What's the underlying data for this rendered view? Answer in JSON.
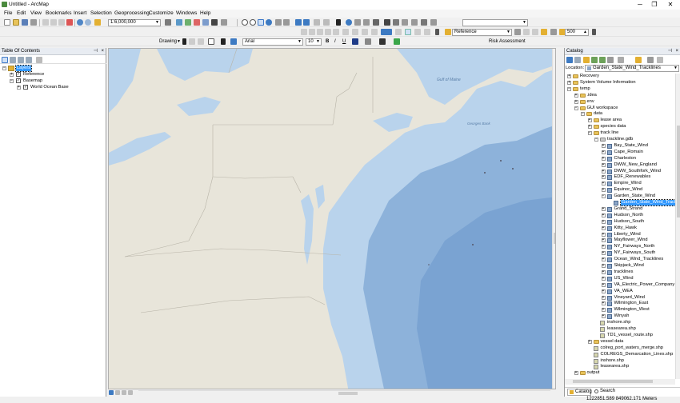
{
  "window": {
    "title": "Untitled - ArcMap",
    "minimize": "─",
    "maximize": "❐",
    "close": "✕"
  },
  "menu": [
    "File",
    "Edit",
    "View",
    "Bookmarks",
    "Insert",
    "Selection",
    "Geoprocessing",
    "Customize",
    "Windows",
    "Help"
  ],
  "toolbar": {
    "scale": "1:6,000,000",
    "drawing_label": "Drawing",
    "font_name": "Arial",
    "font_size": "10",
    "bold": "B",
    "italic": "I",
    "underline": "U",
    "reference_layer": "Reference",
    "zoom_value": "500",
    "risk_assessment": "Risk Assessment"
  },
  "toc": {
    "title": "Table Of Contents",
    "items": [
      {
        "label": "Layers",
        "level": 0,
        "selected": true
      },
      {
        "label": "Reference",
        "level": 1
      },
      {
        "label": "Basemap",
        "level": 1
      },
      {
        "label": "World Ocean Base",
        "level": 2
      }
    ]
  },
  "catalog": {
    "title": "Catalog",
    "location_label": "Location:",
    "location_value": "Garden_State_Wind_Tracklines",
    "items": [
      {
        "label": "Recovery",
        "level": 0,
        "type": "folder"
      },
      {
        "label": "System Volume Information",
        "level": 0,
        "type": "folder"
      },
      {
        "label": "temp",
        "level": 0,
        "type": "folder"
      },
      {
        "label": ".idea",
        "level": 1,
        "type": "folder"
      },
      {
        "label": "env",
        "level": 1,
        "type": "folder"
      },
      {
        "label": "GUI workspace",
        "level": 1,
        "type": "folder"
      },
      {
        "label": "data",
        "level": 2,
        "type": "folder"
      },
      {
        "label": "lease area",
        "level": 3,
        "type": "folder"
      },
      {
        "label": "species data",
        "level": 3,
        "type": "folder"
      },
      {
        "label": "track line",
        "level": 3,
        "type": "folder"
      },
      {
        "label": "trackline.gdb",
        "level": 4,
        "type": "gdb"
      },
      {
        "label": "Bay_State_Wind",
        "level": 5,
        "type": "fc"
      },
      {
        "label": "Cape_Romain",
        "level": 5,
        "type": "fc"
      },
      {
        "label": "Charleston",
        "level": 5,
        "type": "fc"
      },
      {
        "label": "DWW_New_England",
        "level": 5,
        "type": "fc"
      },
      {
        "label": "DWW_Southfork_Wind",
        "level": 5,
        "type": "fc"
      },
      {
        "label": "EDF_Renewables",
        "level": 5,
        "type": "fc"
      },
      {
        "label": "Empire_Wind",
        "level": 5,
        "type": "fc"
      },
      {
        "label": "Equinor_Wind",
        "level": 5,
        "type": "fc"
      },
      {
        "label": "Garden_State_Wind",
        "level": 5,
        "type": "fc"
      },
      {
        "label": "Garden_State_Wind_Tracklines",
        "level": 6,
        "type": "fc",
        "selected": true
      },
      {
        "label": "Grand_Strand",
        "level": 5,
        "type": "fc"
      },
      {
        "label": "Hudson_North",
        "level": 5,
        "type": "fc"
      },
      {
        "label": "Hudson_South",
        "level": 5,
        "type": "fc"
      },
      {
        "label": "Kitty_Hawk",
        "level": 5,
        "type": "fc"
      },
      {
        "label": "Liberty_Wind",
        "level": 5,
        "type": "fc"
      },
      {
        "label": "Mayflower_Wind",
        "level": 5,
        "type": "fc"
      },
      {
        "label": "NY_Fairways_North",
        "level": 5,
        "type": "fc"
      },
      {
        "label": "NY_Fairways_South",
        "level": 5,
        "type": "fc"
      },
      {
        "label": "Ocean_Wind_Tracklines",
        "level": 5,
        "type": "fc"
      },
      {
        "label": "Skipjack_Wind",
        "level": 5,
        "type": "fc"
      },
      {
        "label": "tracklines",
        "level": 5,
        "type": "fc"
      },
      {
        "label": "US_Wind",
        "level": 5,
        "type": "fc"
      },
      {
        "label": "VA_Electric_Power_Company",
        "level": 5,
        "type": "fc"
      },
      {
        "label": "VA_WEA",
        "level": 5,
        "type": "fc"
      },
      {
        "label": "Vineyard_Wind",
        "level": 5,
        "type": "fc"
      },
      {
        "label": "Wilmington_East",
        "level": 5,
        "type": "fc"
      },
      {
        "label": "Wilmington_West",
        "level": 5,
        "type": "fc"
      },
      {
        "label": "Winyah",
        "level": 5,
        "type": "fc"
      },
      {
        "label": "inshore.shp",
        "level": 4,
        "type": "shp"
      },
      {
        "label": "leasearea.shp",
        "level": 4,
        "type": "shp"
      },
      {
        "label": "TD1_vessel_route.shp",
        "level": 4,
        "type": "shp"
      },
      {
        "label": "vessel data",
        "level": 3,
        "type": "folder"
      },
      {
        "label": "colreg_port_waters_merge.shp",
        "level": 3,
        "type": "shp"
      },
      {
        "label": "COLREGS_Demarcation_Lines.shp",
        "level": 3,
        "type": "shp"
      },
      {
        "label": "inshore.shp",
        "level": 3,
        "type": "shp"
      },
      {
        "label": "leasearea.shp",
        "level": 3,
        "type": "shp"
      },
      {
        "label": "output",
        "level": 1,
        "type": "folder"
      }
    ],
    "tabs": [
      "Catalog",
      "Search"
    ]
  },
  "map": {
    "labels": [
      "Gulf of Maine",
      "Georges Bank"
    ]
  },
  "status": {
    "coords": "1222851.589  849062.171 Meters"
  },
  "colors": {
    "ocean": "#a9c6e3",
    "deep_ocean": "#7fa6d3",
    "land": "#e8e5da",
    "selection": "#3399ff"
  }
}
